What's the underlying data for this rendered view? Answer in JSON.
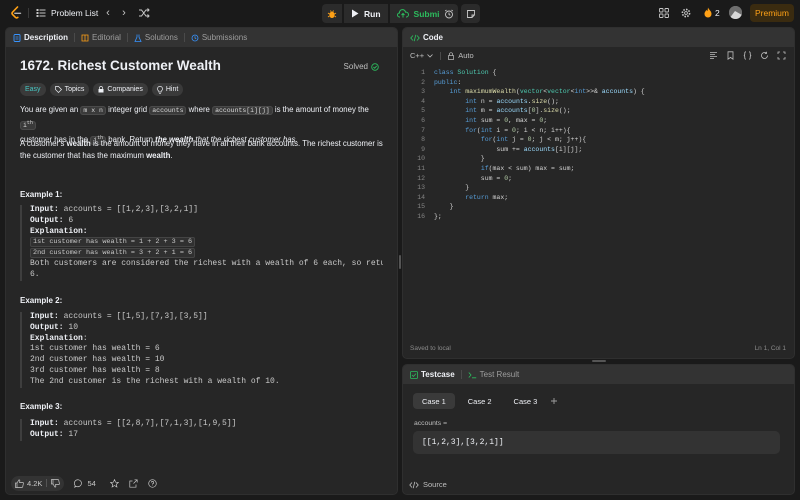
{
  "topnav": {
    "problem_list": "Problem List",
    "run": "Run",
    "submit": "Submit",
    "streak": "2",
    "premium": "Premium"
  },
  "left_tabs": [
    "Description",
    "Editorial",
    "Solutions",
    "Submissions"
  ],
  "problem": {
    "title": "1672. Richest Customer Wealth",
    "status": "Solved",
    "chips": [
      "Easy",
      "Topics",
      "Companies",
      "Hint"
    ]
  },
  "examples_titles": [
    "Example 1:",
    "Example 2:",
    "Example 3:"
  ],
  "bottom_bar": {
    "likes": "4.2K",
    "comments": "54"
  },
  "code_tab": "Code",
  "language": "C++",
  "autocomplete": "Auto",
  "code_lines": [
    "class Solution {",
    "public:",
    "    int maximumWealth(vector<vector<int>>& accounts) {",
    "        int n = accounts.size();",
    "        int m = accounts[0].size();",
    "        int sum = 0, max = 0;",
    "        for(int i = 0; i < n; i++){",
    "            for(int j = 0; j < m; j++){",
    "                sum += accounts[i][j];",
    "            }",
    "            if(max < sum) max = sum;",
    "            sum = 0;",
    "        }",
    "        return max;",
    "    }",
    "};"
  ],
  "code_status": {
    "saved": "Saved to local",
    "cursor": "Ln 1, Col 1"
  },
  "test_tabs": [
    "Testcase",
    "Test Result"
  ],
  "cases": [
    "Case 1",
    "Case 2",
    "Case 3"
  ],
  "testcase": {
    "label": "accounts =",
    "value": "[[1,2,3],[3,2,1]]"
  },
  "source": "Source"
}
